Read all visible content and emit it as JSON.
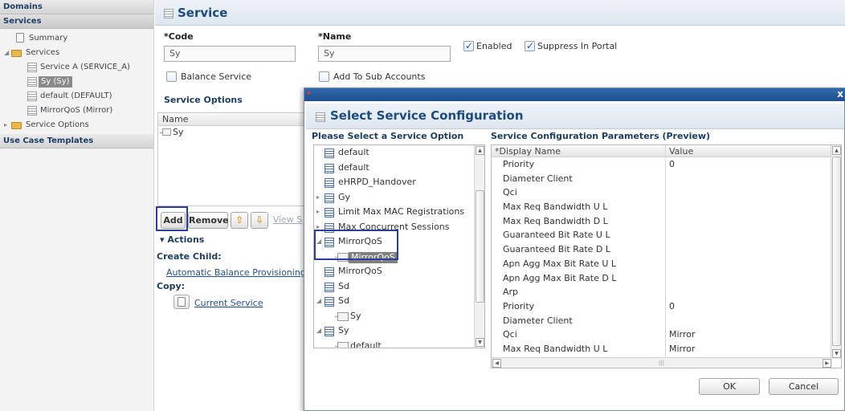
{
  "sidebar": {
    "domains_header": "Domains",
    "services_header": "Services",
    "use_case_header": "Use Case Templates",
    "tree": {
      "summary": "Summary",
      "services": "Services",
      "service_a": "Service A (SERVICE_A)",
      "sy": "Sy (Sy)",
      "default": "default (DEFAULT)",
      "mirrorqos": "MirrorQoS (Mirror)",
      "service_options": "Service Options"
    }
  },
  "main": {
    "title": "Service",
    "code_label": "*Code",
    "code_value": "Sy",
    "name_label": "*Name",
    "name_value": "Sy",
    "enabled_label": "Enabled",
    "suppress_label": "Suppress In Portal",
    "balance_label": "Balance Service",
    "add_sub_label": "Add To Sub Accounts",
    "service_options_title": "Service Options",
    "grid_header": "Name",
    "grid_rows": [
      "Sy"
    ],
    "add_button": "Add",
    "remove_button": "Remove",
    "up_arrow": "⇧",
    "down_arrow": "⇩",
    "view_button": "View S",
    "actions_header": "▾ Actions",
    "create_child_label": "Create Child:",
    "create_child_link": "Automatic Balance Provisioning",
    "copy_label": "Copy:",
    "copy_link": "Current Service",
    "enabled_checked": true,
    "suppress_checked": true
  },
  "modal": {
    "close": "x",
    "title": "Select Service Configuration",
    "left_label": "Please Select a Service Option",
    "right_label": "Service Configuration Parameters (Preview)",
    "options": [
      {
        "label": "default"
      },
      {
        "label": "default"
      },
      {
        "label": "eHRPD_Handover"
      },
      {
        "label": "Gy"
      },
      {
        "label": "Limit Max MAC Registrations"
      },
      {
        "label": "Max Concurrent Sessions"
      },
      {
        "label": "MirrorQoS"
      },
      {
        "label": "MirrorQoS"
      },
      {
        "label": "MirrorQoS"
      },
      {
        "label": "Sd"
      },
      {
        "label": "Sd"
      },
      {
        "label": "Sy"
      },
      {
        "label": "Sy"
      },
      {
        "label": "default"
      }
    ],
    "param_header_name": "*Display Name",
    "param_header_value": "Value",
    "params": [
      {
        "name": "Priority",
        "value": "0"
      },
      {
        "name": "Diameter Client",
        "value": ""
      },
      {
        "name": "Qci",
        "value": ""
      },
      {
        "name": "Max Req Bandwidth U L",
        "value": ""
      },
      {
        "name": "Max Req Bandwidth D L",
        "value": ""
      },
      {
        "name": "Guaranteed Bit Rate U L",
        "value": ""
      },
      {
        "name": "Guaranteed Bit Rate D L",
        "value": ""
      },
      {
        "name": "Apn Agg Max Bit Rate U L",
        "value": ""
      },
      {
        "name": "Apn Agg Max Bit Rate D L",
        "value": ""
      },
      {
        "name": "Arp",
        "value": ""
      },
      {
        "name": "Priority",
        "value": "0"
      },
      {
        "name": "Diameter Client",
        "value": ""
      },
      {
        "name": "Qci",
        "value": "Mirror"
      },
      {
        "name": "Max Req Bandwidth U L",
        "value": "Mirror"
      }
    ],
    "ok_button": "OK",
    "cancel_button": "Cancel",
    "scroll_grip": "|||"
  }
}
